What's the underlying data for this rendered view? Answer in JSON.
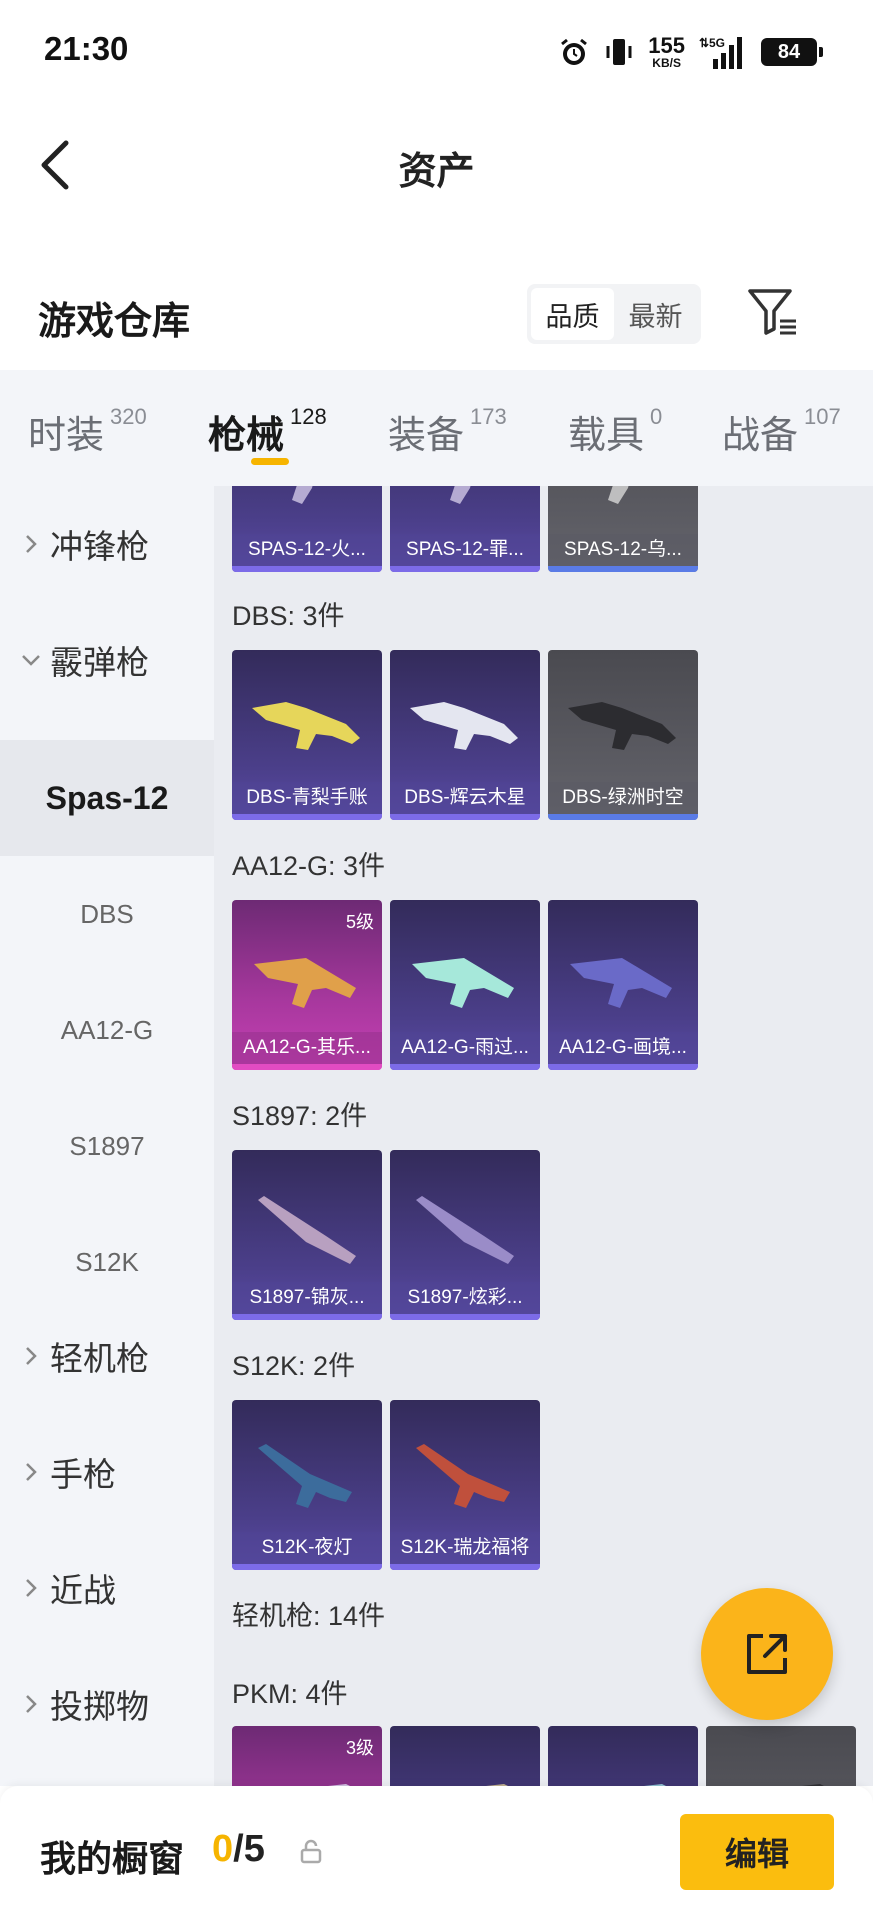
{
  "status_bar": {
    "time": "21:30",
    "net_speed_value": "155",
    "net_speed_unit": "KB/S",
    "network": "5G",
    "battery": "84",
    "icons": [
      "alarm-icon",
      "vibrate-icon",
      "signal-icon",
      "battery-icon"
    ]
  },
  "header": {
    "title": "资产",
    "back_icon": "chevron-left-icon"
  },
  "section": {
    "title": "游戏仓库",
    "sort_options": [
      "品质",
      "最新"
    ],
    "sort_selected": "品质",
    "filter_icon": "filter-icon"
  },
  "category_tabs": [
    {
      "label": "时装",
      "count": "320"
    },
    {
      "label": "枪械",
      "count": "128",
      "active": true
    },
    {
      "label": "装备",
      "count": "173"
    },
    {
      "label": "载具",
      "count": "0"
    },
    {
      "label": "战备",
      "count": "107"
    }
  ],
  "sidebar": {
    "items": [
      {
        "label": "冲锋枪",
        "type": "group",
        "expanded": false
      },
      {
        "label": "霰弹枪",
        "type": "group",
        "expanded": true
      },
      {
        "label": "Spas-12",
        "type": "sub",
        "selected": true
      },
      {
        "label": "DBS",
        "type": "sub"
      },
      {
        "label": "AA12-G",
        "type": "sub"
      },
      {
        "label": "S1897",
        "type": "sub"
      },
      {
        "label": "S12K",
        "type": "sub"
      },
      {
        "label": "轻机枪",
        "type": "group",
        "expanded": false
      },
      {
        "label": "手枪",
        "type": "group",
        "expanded": false
      },
      {
        "label": "近战",
        "type": "group",
        "expanded": false
      },
      {
        "label": "投掷物",
        "type": "group",
        "expanded": false
      }
    ]
  },
  "content": {
    "top_row": [
      {
        "name": "SPAS-12-火...",
        "style": "purple"
      },
      {
        "name": "SPAS-12-罪...",
        "style": "purple"
      },
      {
        "name": "SPAS-12-乌...",
        "style": "gray"
      }
    ],
    "groups": [
      {
        "label": "DBS: 3件",
        "items": [
          {
            "name": "DBS-青梨手账",
            "style": "purple"
          },
          {
            "name": "DBS-辉云木星",
            "style": "purple"
          },
          {
            "name": "DBS-绿洲时空",
            "style": "gray"
          }
        ]
      },
      {
        "label": "AA12-G: 3件",
        "items": [
          {
            "name": "AA12-G-其乐...",
            "style": "pink",
            "level": "5级"
          },
          {
            "name": "AA12-G-雨过...",
            "style": "purple"
          },
          {
            "name": "AA12-G-画境...",
            "style": "purple"
          }
        ]
      },
      {
        "label": "S1897: 2件",
        "items": [
          {
            "name": "S1897-锦灰...",
            "style": "purple"
          },
          {
            "name": "S1897-炫彩...",
            "style": "purple"
          }
        ]
      },
      {
        "label": "S12K: 2件",
        "items": [
          {
            "name": "S12K-夜灯",
            "style": "purple"
          },
          {
            "name": "S12K-瑞龙福将",
            "style": "purple"
          }
        ]
      }
    ],
    "category_label": "轻机枪: 14件",
    "pkm_label": "PKM: 4件",
    "pkm_items": [
      {
        "style": "pink",
        "level": "3级"
      },
      {
        "style": "purple"
      },
      {
        "style": "purple"
      },
      {
        "style": "gray"
      }
    ]
  },
  "fab": {
    "icon": "share-export-icon"
  },
  "bottom_bar": {
    "label": "我的橱窗",
    "count_current": "0",
    "count_total": "/5",
    "lock_icon": "lock-icon",
    "edit_label": "编辑"
  }
}
